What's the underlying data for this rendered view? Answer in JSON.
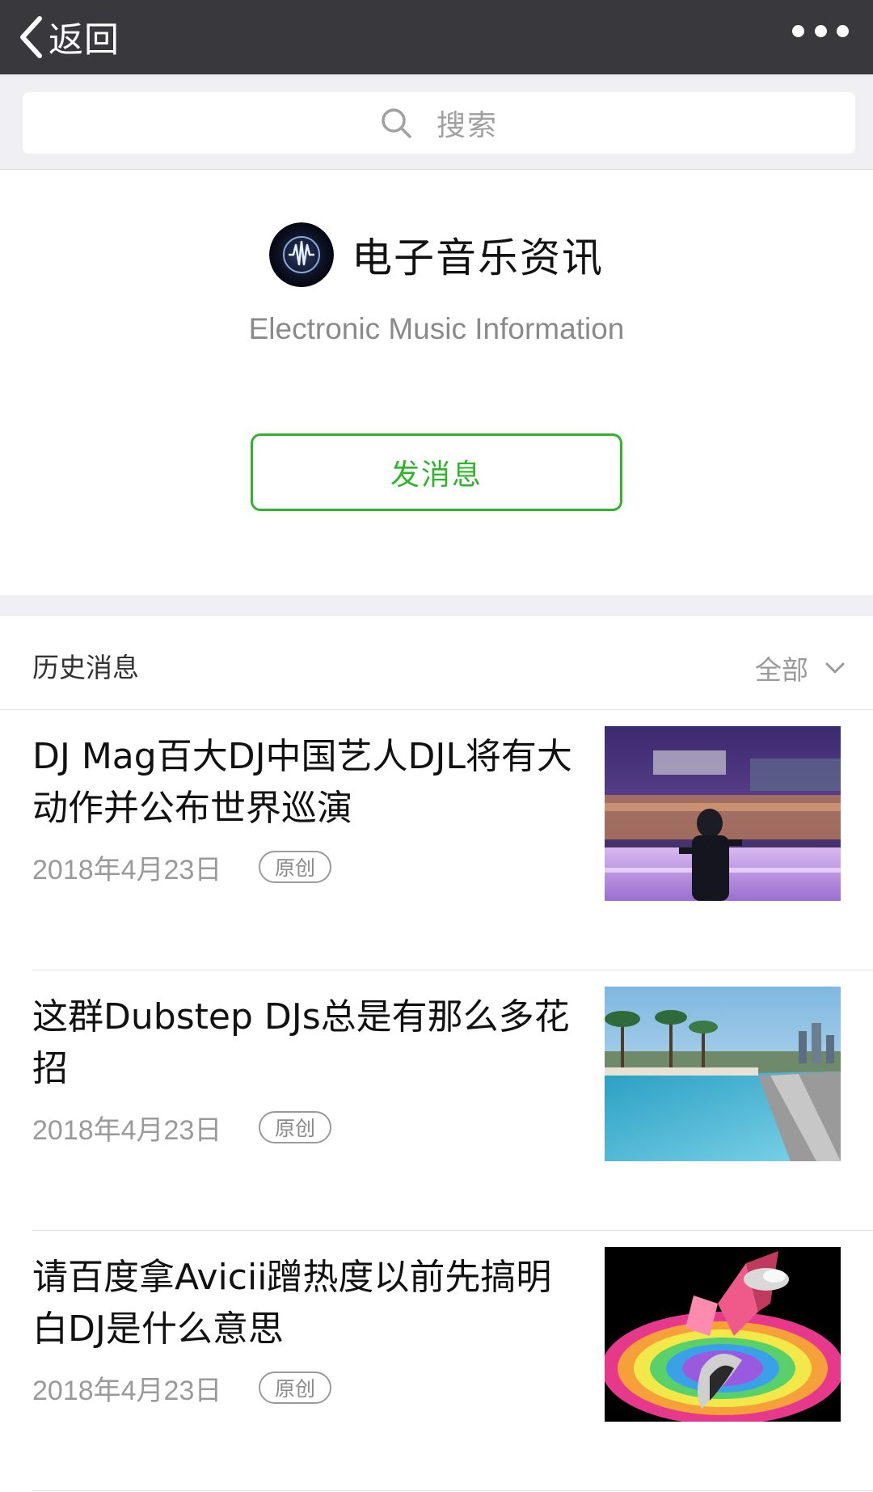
{
  "nav": {
    "back_label": "返回"
  },
  "search": {
    "placeholder": "搜索"
  },
  "profile": {
    "name": "电子音乐资讯",
    "description": "Electronic Music Information",
    "send_button": "发消息"
  },
  "history": {
    "title": "历史消息",
    "filter_label": "全部"
  },
  "articles": [
    {
      "title": "DJ Mag百大DJ中国艺人DJL将有大动作并公布世界巡演",
      "date": "2018年4月23日",
      "tag": "原创"
    },
    {
      "title": "这群Dubstep DJs总是有那么多花招",
      "date": "2018年4月23日",
      "tag": "原创"
    },
    {
      "title": "请百度拿Avicii蹭热度以前先搞明白DJ是什么意思",
      "date": "2018年4月23日",
      "tag": "原创"
    }
  ],
  "colors": {
    "topbar": "#38383d",
    "accent_green": "#2fb52c",
    "background_gray": "#efeff4"
  }
}
